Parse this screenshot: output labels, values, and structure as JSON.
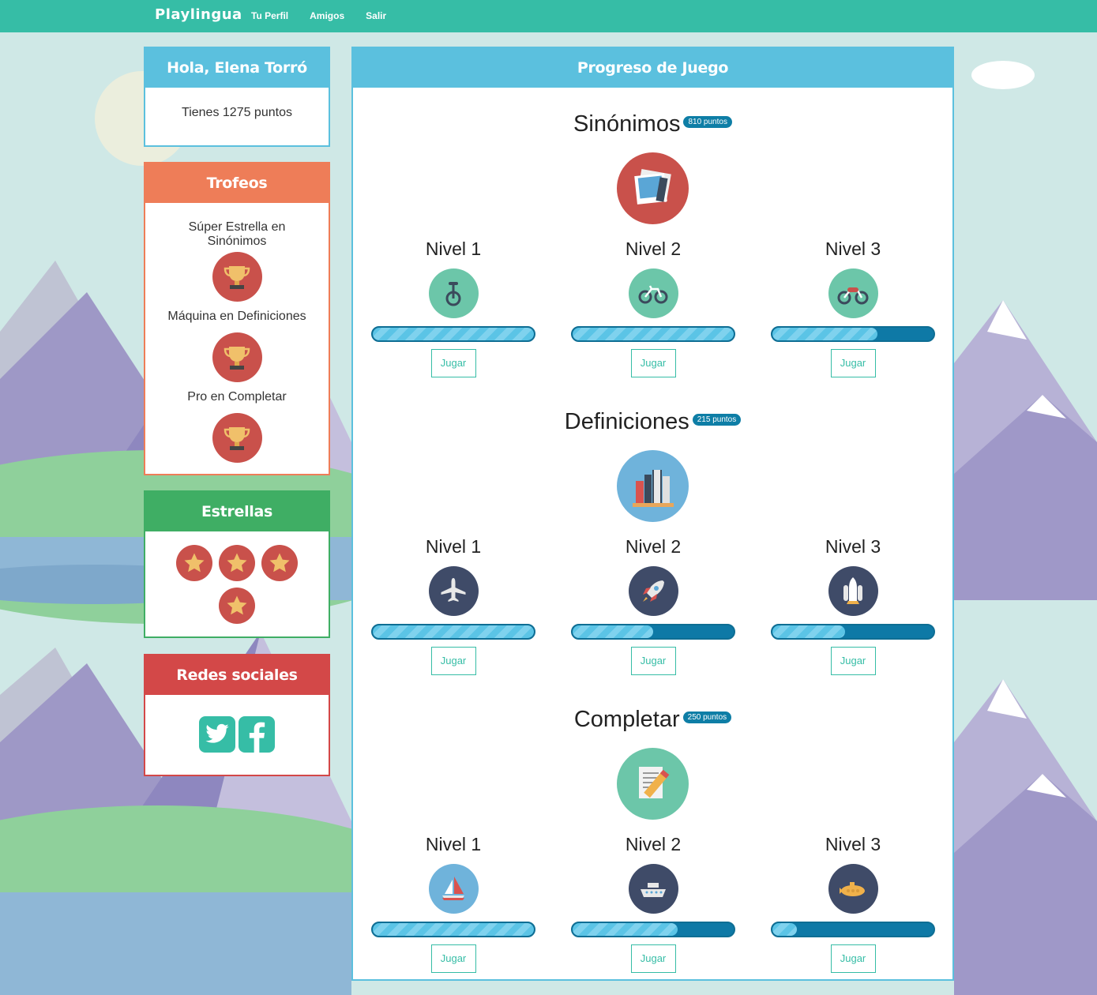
{
  "nav": {
    "brand": "Playlingua",
    "links": [
      "Tu Perfil",
      "Amigos",
      "Salir"
    ]
  },
  "greeting": {
    "title": "Hola, Elena Torró",
    "points_text": "Tienes 1275 puntos"
  },
  "trophies": {
    "title": "Trofeos",
    "items": [
      "Súper Estrella en Sinónimos",
      "Máquina en Definiciones",
      "Pro en Completar"
    ]
  },
  "stars": {
    "title": "Estrellas",
    "count": 4
  },
  "social": {
    "title": "Redes sociales"
  },
  "progress": {
    "title": "Progreso de Juego",
    "button_label": "Jugar",
    "games": [
      {
        "name": "Sinónimos",
        "points": "810 puntos",
        "icon": "photos-icon",
        "icon_color": "#c9514b",
        "levels": [
          {
            "name": "Nivel 1",
            "icon": "unicycle-icon",
            "progress": 1.0
          },
          {
            "name": "Nivel 2",
            "icon": "bicycle-icon",
            "progress": 1.0
          },
          {
            "name": "Nivel 3",
            "icon": "motorcycle-icon",
            "progress": 0.65
          }
        ]
      },
      {
        "name": "Definiciones",
        "points": "215 puntos",
        "icon": "books-icon",
        "icon_color": "#6fb3db",
        "levels": [
          {
            "name": "Nivel 1",
            "icon": "airplane-icon",
            "progress": 1.0
          },
          {
            "name": "Nivel 2",
            "icon": "rocket-icon",
            "progress": 0.5
          },
          {
            "name": "Nivel 3",
            "icon": "space-shuttle-icon",
            "progress": 0.45
          }
        ]
      },
      {
        "name": "Completar",
        "points": "250 puntos",
        "icon": "notepad-pencil-icon",
        "icon_color": "#6cc6a9",
        "levels": [
          {
            "name": "Nivel 1",
            "icon": "sailboat-icon",
            "progress": 1.0
          },
          {
            "name": "Nivel 2",
            "icon": "ship-icon",
            "progress": 0.65
          },
          {
            "name": "Nivel 3",
            "icon": "submarine-icon",
            "progress": 0.15
          }
        ]
      }
    ]
  },
  "colors": {
    "nav": "#36bda6",
    "blue": "#5bc0de",
    "orange": "#ee7d58",
    "green": "#3fae64",
    "red": "#d34848",
    "accent": "#0e7ea6"
  }
}
